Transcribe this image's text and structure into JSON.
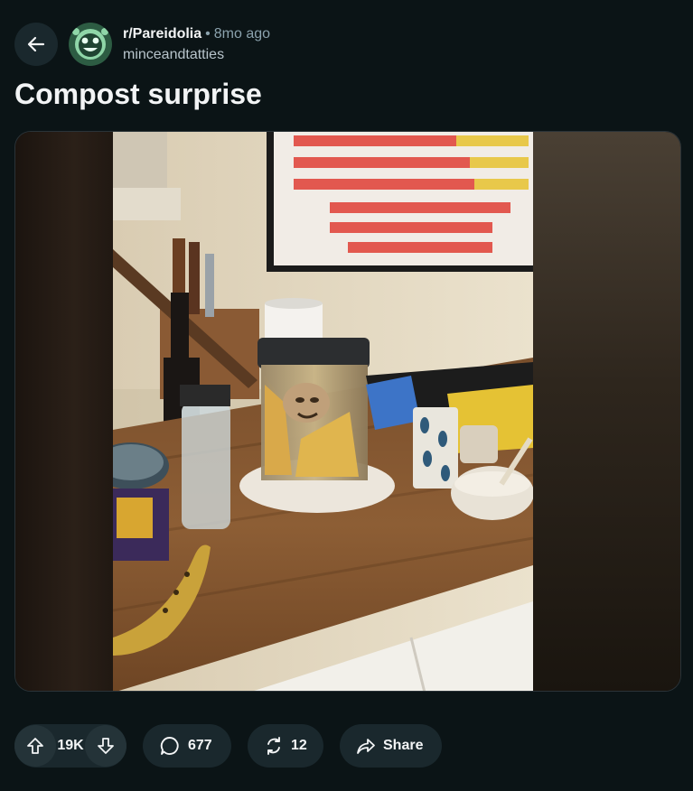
{
  "post": {
    "subreddit": "r/Pareidolia",
    "separator": "•",
    "time_ago": "8mo ago",
    "username": "minceandtatties",
    "title": "Compost surprise"
  },
  "actions": {
    "score": "19K",
    "comments": "677",
    "reposts": "12",
    "share_label": "Share"
  },
  "icons": {
    "back": "back-arrow-icon",
    "upvote": "upvote-icon",
    "downvote": "downvote-icon",
    "comment": "comment-icon",
    "repost": "repost-icon",
    "share": "share-icon"
  },
  "colors": {
    "background": "#0b1416",
    "pill": "#1a282d",
    "muted_text": "#8ba2ad"
  }
}
